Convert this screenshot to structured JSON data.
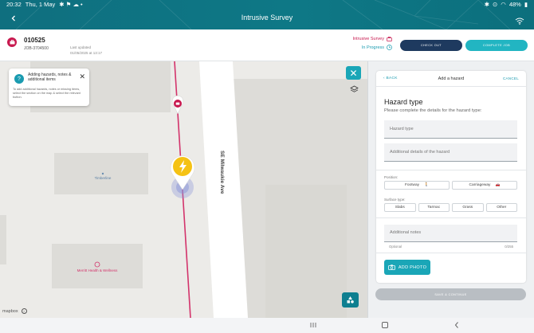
{
  "status_bar": {
    "time": "20:32",
    "date": "Thu, 1 May",
    "battery": "48%",
    "icons": [
      "bluetooth-icon",
      "location-icon",
      "wifi-icon",
      "battery-icon"
    ]
  },
  "app_bar": {
    "title": "Intrusive Survey"
  },
  "job": {
    "number": "010525",
    "reference": "JOB-3704500",
    "last_updated_label": "Last updated",
    "last_updated_value": "01/05/2025 at 13:17",
    "survey_type": "Intrusive Survey",
    "survey_status": "In Progress",
    "check_label": "CHECK OUT",
    "complete_label": "COMPLETE JOB"
  },
  "map": {
    "tooltip_title": "Adding hazards, notes & additional items",
    "tooltip_body": "To add additional hazards, notes or missing items, select the section on the map & select the relevant button.",
    "street_name": "SE Milwaukie Ave",
    "poi_1": "Timberline",
    "poi_2": "Merritt Health & Wellness",
    "attribution": "mapbox",
    "info": "i"
  },
  "panel": {
    "back_label": "BACK",
    "title": "Add a hazard",
    "cancel_label": "CANCEL",
    "heading": "Hazard type",
    "subheading": "Please complete the details for the hazard type:",
    "field_hazard_type": "Hazard type",
    "field_details": "Additional details of the hazard",
    "position_label": "Position:",
    "position_options": [
      "Footway",
      "Carriageway"
    ],
    "surface_label": "Surface type:",
    "surface_options": [
      "Slabs",
      "Tarmac",
      "Grass",
      "Other"
    ],
    "notes_label": "Additional notes",
    "optional_label": "Optional",
    "counter": "0/255",
    "add_photo_label": "ADD PHOTO",
    "save_label": "SAVE & CONTINUE"
  },
  "colors": {
    "header": "#0e7886",
    "accent": "#1aa6b7",
    "brand_pink": "#c8194f",
    "check_btn": "#1e3a5f",
    "pin_yellow": "#f5c214"
  }
}
